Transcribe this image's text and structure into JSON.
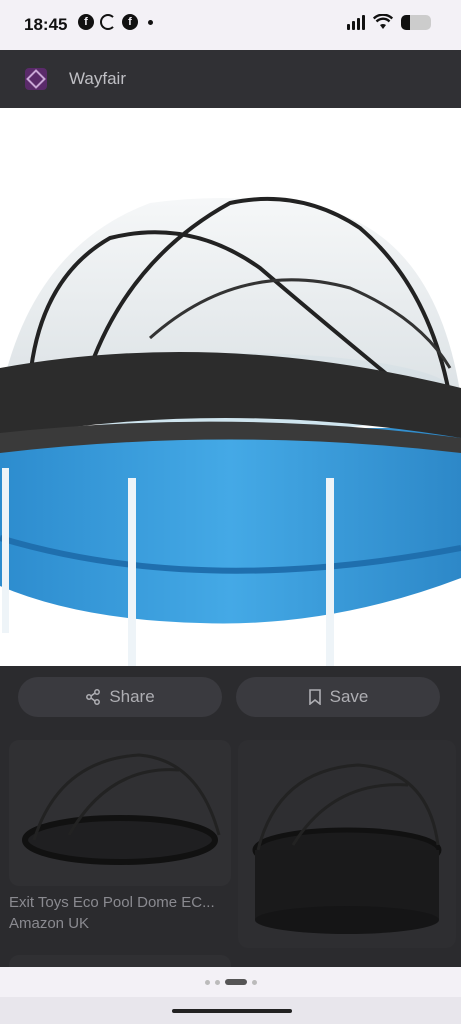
{
  "status_bar": {
    "time": "18:45",
    "notification_icons": [
      "facebook-icon",
      "sync-icon",
      "facebook-icon"
    ],
    "system_icons": [
      "signal-icon",
      "wifi-icon",
      "battery-icon"
    ]
  },
  "source": {
    "name": "Wayfair",
    "logo_icon": "wayfair-logo-icon",
    "logo_color": "#5a2a6a"
  },
  "actions": {
    "share_label": "Share",
    "save_label": "Save"
  },
  "results": [
    {
      "title": "Exit Toys Eco Pool Dome EC...",
      "source": "Amazon UK"
    },
    {
      "title": "",
      "source": ""
    }
  ],
  "pager": {
    "count": 4,
    "active_index": 2
  },
  "colors": {
    "pool_blue": "#3aa0dd",
    "overlay": "#2b2b2e"
  }
}
